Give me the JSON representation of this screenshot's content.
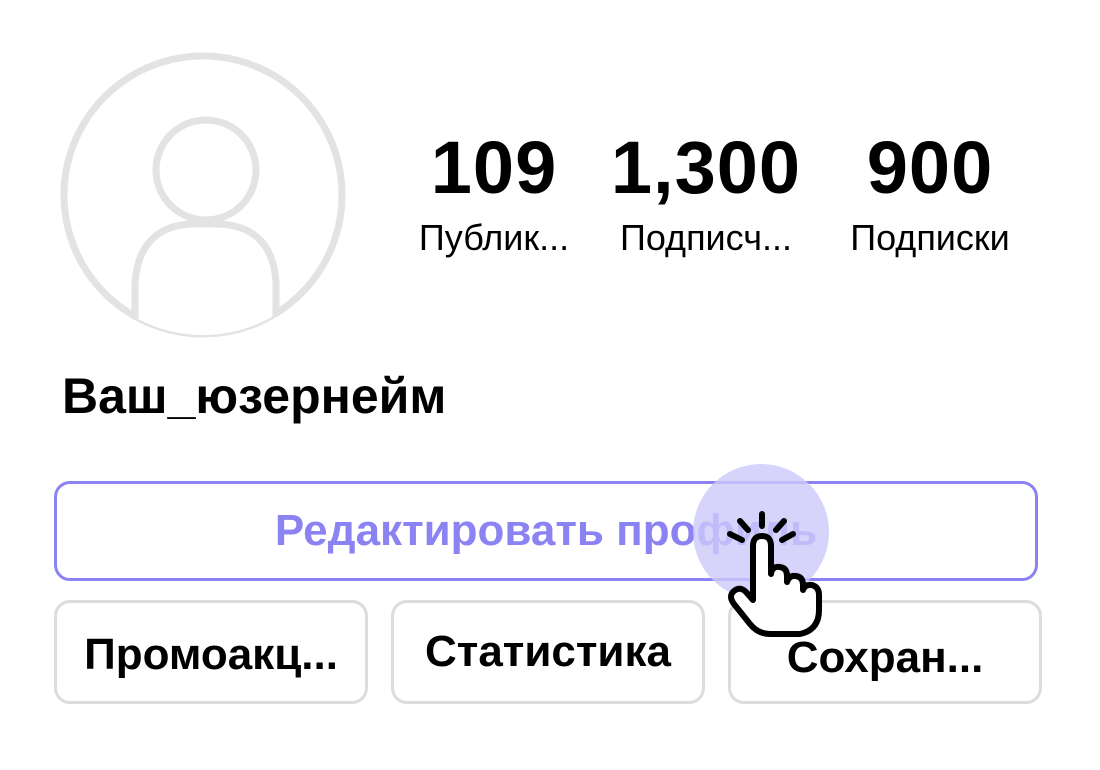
{
  "profile": {
    "avatar_icon": "user-silhouette-icon",
    "username": "Ваш_юзернейм"
  },
  "stats": {
    "posts": {
      "value": "109",
      "label": "Публик..."
    },
    "followers": {
      "value": "1,300",
      "label": "Подписч..."
    },
    "following": {
      "value": "900",
      "label": "Подписки"
    }
  },
  "actions": {
    "edit_profile_label": "Редактировать профиль",
    "promotions_label": "Промоакц...",
    "statistics_label": "Статистика",
    "saved_label": "Сохран..."
  },
  "pointer": {
    "icon": "hand-pointer-click-icon"
  },
  "colors": {
    "accent": "#8b83f2",
    "highlight": "#cdc9fa",
    "border_gray": "#dcdcdc",
    "avatar_gray": "#e3e3e3"
  }
}
